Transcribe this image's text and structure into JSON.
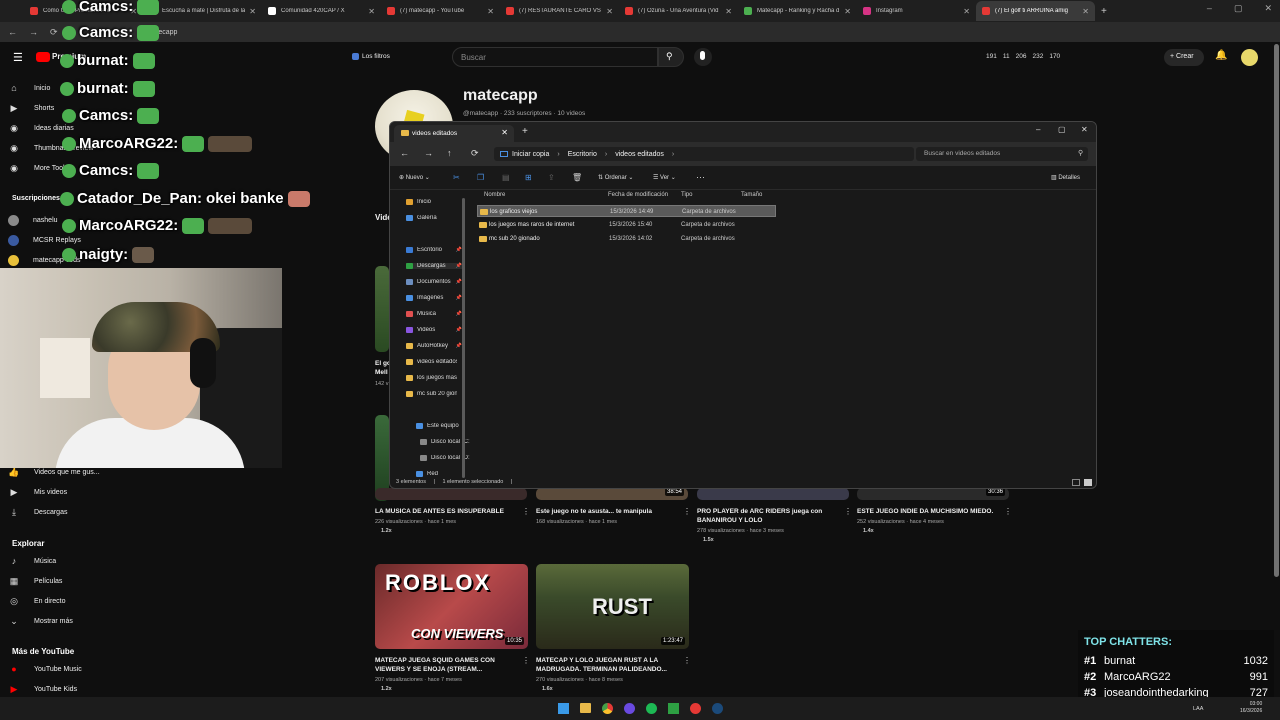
{
  "tabs": [
    {
      "title": "Como Usar Premiere Pro",
      "color": "#e53935"
    },
    {
      "title": "Escucha a mate | Disfruta de la",
      "color": "#e53935"
    },
    {
      "title": "Comunidad 420CAP / X",
      "color": "#ffffff"
    },
    {
      "title": "(7) matecapp - YouTube",
      "color": "#e53935"
    },
    {
      "title": "(7) RESTAURANTE CARO VS BA",
      "color": "#e53935"
    },
    {
      "title": "(7) Ozuna - Una Aventura (Vid",
      "color": "#e53935"
    },
    {
      "title": "Matecapp - Ranking y Racha d",
      "color": "#4caf50"
    },
    {
      "title": "Instagram",
      "color": "#d63384"
    },
    {
      "title": "(7) El golf ti ARRUINA amig",
      "color": "#e53935"
    }
  ],
  "address": "@matecapp",
  "youtube": {
    "logo": "Premium",
    "filter_chip": "Los filtros",
    "search_placeholder": "Buscar",
    "stats": [
      "191",
      "11",
      "206",
      "232",
      "170"
    ],
    "create": "Crear",
    "channel_name": "matecapp",
    "channel_meta": "@matecapp · 233 suscriptores · 10 videos",
    "sidebar_top": [
      {
        "label": "Inicio",
        "icon": "home-icon"
      },
      {
        "label": "Shorts",
        "icon": "shorts-icon"
      },
      {
        "label": "Ideas diarias",
        "icon": "ideas-icon"
      },
      {
        "label": "Thumbnail Preview",
        "icon": "thumbnail-icon"
      },
      {
        "label": "More Tools",
        "icon": "tools-icon"
      }
    ],
    "subs_header": "Suscripciones",
    "subs": [
      "nashelu",
      "MCSR Replays",
      "matecapp vods"
    ],
    "sidebar_mid": [
      {
        "label": "Videos que me gus...",
        "icon": "like-icon"
      },
      {
        "label": "Mis videos",
        "icon": "play-icon"
      },
      {
        "label": "Descargas",
        "icon": "download-icon"
      }
    ],
    "explore_header": "Explorar",
    "explore": [
      {
        "label": "Música",
        "icon": "music-icon"
      },
      {
        "label": "Películas",
        "icon": "movie-icon"
      },
      {
        "label": "En directo",
        "icon": "live-icon"
      },
      {
        "label": "Mostrar más",
        "icon": "chevron-down-icon"
      }
    ],
    "more_header": "Más de YouTube",
    "more": [
      {
        "label": "YouTube Music",
        "icon": "youtube-music-icon"
      },
      {
        "label": "YouTube Kids",
        "icon": "youtube-kids-icon"
      }
    ],
    "videos_row1": [
      {
        "title": "LA MUSICA DE ANTES ES INSUPERABLE",
        "meta": "226 visualizaciones · hace 1 mes",
        "mult": "1.2x"
      },
      {
        "title": "Este juego no te asusta... te manipula",
        "meta": "168 visualizaciones · hace 1 mes",
        "dur": "38:54",
        "mult": ""
      },
      {
        "title": "PRO PLAYER de ARC RIDERS juega con BANANIROU Y LOLO",
        "meta": "278 visualizaciones · hace 3 meses",
        "mult": "1.5x"
      },
      {
        "title": "ESTE JUEGO INDIE DA MUCHISIMO MIEDO.",
        "meta": "252 visualizaciones · hace 4 meses",
        "dur": "30:36",
        "mult": "1.4x"
      }
    ],
    "videos_row2": [
      {
        "title": "MATECAP JUEGA SQUID GAMES CON VIEWERS Y SE ENOJA (STREAM...",
        "meta": "207 visualizaciones · hace 7 meses",
        "dur": "10:35",
        "mult": "1.2x",
        "thumb_text": "ROBLOX",
        "thumb_sub": "CON VIEWERS"
      },
      {
        "title": "MATECAP Y LOLO JUEGAN RUST A LA MADRUGADA. TERMINAN PALIDEANDO...",
        "meta": "270 visualizaciones · hace 8 meses",
        "dur": "1:23:47",
        "mult": "1.6x",
        "thumb_text": "RUST"
      }
    ],
    "partial_left": [
      {
        "title": "El go",
        "meta": "Mell"
      },
      {
        "meta": "142 v"
      }
    ],
    "vid_label": "Vide"
  },
  "chat": [
    {
      "user": "Camcs:",
      "color": "#ffffff"
    },
    {
      "user": "Camcs:",
      "color": "#ffffff"
    },
    {
      "user": "burnat:",
      "color": "#ffffff"
    },
    {
      "user": "burnat:",
      "color": "#ffffff"
    },
    {
      "user": "Camcs:",
      "color": "#ffffff"
    },
    {
      "user": "MarcoARG22:",
      "color": "#ffffff"
    },
    {
      "user": "Camcs:",
      "color": "#ffffff"
    },
    {
      "user": "Catador_De_Pan:",
      "msg": "okei banke",
      "color": "#ffffff"
    },
    {
      "user": "MarcoARG22:",
      "color": "#ffffff"
    },
    {
      "user": "naigty:",
      "color": "#ffffff"
    }
  ],
  "explorer": {
    "tab_title": "videos editados",
    "breadcrumb": [
      "Iniciar copia",
      "Escritorio",
      "videos editados"
    ],
    "search_placeholder": "Buscar en videos editados",
    "toolbar": {
      "new": "Nuevo",
      "sort": "Ordenar",
      "view": "Ver",
      "details": "Detalles"
    },
    "nav": [
      {
        "label": "Inicio",
        "color": "#e0a030"
      },
      {
        "label": "Galería",
        "color": "#4a8fe0"
      },
      {
        "label": "Escritorio",
        "color": "#3a7bd5",
        "pin": true
      },
      {
        "label": "Descargas",
        "color": "#2ea043",
        "pin": true
      },
      {
        "label": "Documentos",
        "color": "#6c8ebf",
        "pin": true
      },
      {
        "label": "Imágenes",
        "color": "#4a90e2",
        "pin": true
      },
      {
        "label": "Música",
        "color": "#e05050",
        "pin": true
      },
      {
        "label": "Videos",
        "color": "#8a56e0",
        "pin": true
      },
      {
        "label": "AutoHotkey",
        "color": "#e8b94a",
        "pin": true
      },
      {
        "label": "videos editados",
        "color": "#e8b94a"
      },
      {
        "label": "los juegos mas r",
        "color": "#e8b94a"
      },
      {
        "label": "mc sub 20 gionc",
        "color": "#e8b94a"
      },
      {
        "label": "Este equipo",
        "color": "#4a90e2"
      },
      {
        "label": "Disco local (C:",
        "color": "#888888"
      },
      {
        "label": "Disco local (D:",
        "color": "#888888"
      },
      {
        "label": "Red",
        "color": "#4a90e2"
      }
    ],
    "columns": [
      "Nombre",
      "Fecha de modificación",
      "Tipo",
      "Tamaño"
    ],
    "rows": [
      {
        "name": "los graficos viejos",
        "date": "15/3/2026 14:49",
        "type": "Carpeta de archivos",
        "selected": true
      },
      {
        "name": "los juegos mas raros de internet",
        "date": "15/3/2026 15:40",
        "type": "Carpeta de archivos"
      },
      {
        "name": "mc sub 20 gionado",
        "date": "15/3/2026 14:02",
        "type": "Carpeta de archivos"
      }
    ],
    "status": [
      "3 elementos",
      "1 elemento seleccionado"
    ]
  },
  "top_chatters": {
    "title": "TOP CHATTERS:",
    "rows": [
      {
        "rank": "#1",
        "name": "burnat",
        "count": "1032"
      },
      {
        "rank": "#2",
        "name": "MarcoARG22",
        "count": "991"
      },
      {
        "rank": "#3",
        "name": "joseandointhedarking",
        "count": "727"
      }
    ]
  },
  "taskbar": {
    "clock_time": "03:00",
    "clock_date": "16/3/2026",
    "lang": "LAA"
  }
}
